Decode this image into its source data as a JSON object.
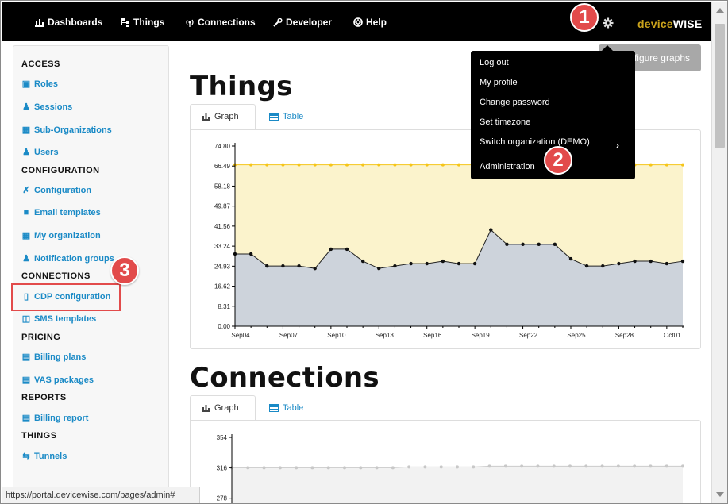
{
  "nav": {
    "items": [
      {
        "label": "Dashboards",
        "icon": "bar-chart-icon"
      },
      {
        "label": "Things",
        "icon": "sitemap-icon"
      },
      {
        "label": "Connections",
        "icon": "signal-icon"
      },
      {
        "label": "Developer",
        "icon": "wrench-icon"
      },
      {
        "label": "Help",
        "icon": "lifebuoy-icon"
      }
    ],
    "logo_prefix": "device",
    "logo_suffix": "WISE"
  },
  "sidebar": {
    "sections": [
      {
        "title": "ACCESS",
        "items": [
          "Roles",
          "Sessions",
          "Sub-Organizations",
          "Users"
        ]
      },
      {
        "title": "CONFIGURATION",
        "items": [
          "Configuration",
          "Email templates",
          "My organization",
          "Notification groups"
        ]
      },
      {
        "title": "CONNECTIONS",
        "items": [
          "CDP configuration",
          "SMS templates"
        ]
      },
      {
        "title": "PRICING",
        "items": [
          "Billing plans",
          "VAS packages"
        ]
      },
      {
        "title": "REPORTS",
        "items": [
          "Billing report"
        ]
      },
      {
        "title": "THINGS",
        "items": [
          "Tunnels"
        ]
      }
    ]
  },
  "main": {
    "things_title": "Things",
    "connections_title": "Connections",
    "tab_graph": "Graph",
    "tab_table": "Table",
    "configure_button": "Configure graphs"
  },
  "dropdown": {
    "items": [
      "Log out",
      "My profile",
      "Change password",
      "Set timezone",
      "Switch organization (DEMO)",
      "Administration"
    ]
  },
  "badges": [
    "1",
    "2",
    "3"
  ],
  "status_url": "https://portal.devicewise.com/pages/admin#",
  "colors": {
    "accent": "#1a8ac6",
    "badge": "#e24b4b",
    "limit_line": "#f5c518",
    "limit_fill": "#fbf3cc",
    "area_fill": "#cdd3db",
    "conn_fill": "#f2f2f2"
  },
  "chart_data": [
    {
      "type": "area",
      "title": "",
      "yticks": [
        "0.00",
        "8.31",
        "16.62",
        "24.93",
        "33.24",
        "41.56",
        "49.87",
        "58.18",
        "66.49",
        "74.80"
      ],
      "ylim": [
        0,
        74.8
      ],
      "xticks": [
        "Sep04",
        "Sep07",
        "Sep10",
        "Sep13",
        "Sep16",
        "Sep19",
        "Sep22",
        "Sep25",
        "Sep28",
        "Oct01"
      ],
      "limit_value": 67,
      "series": [
        {
          "values": [
            30,
            30,
            25,
            25,
            25,
            24,
            32,
            32,
            27,
            24,
            25,
            26,
            26,
            27,
            26,
            26,
            40,
            34,
            34,
            34,
            34,
            28,
            25,
            25,
            26,
            27,
            27,
            26,
            27
          ]
        }
      ]
    },
    {
      "type": "area",
      "title": "",
      "yticks": [
        "278",
        "316",
        "354"
      ],
      "ylim": [
        240,
        354
      ],
      "series": [
        {
          "values": [
            316,
            316,
            316,
            316,
            316,
            316,
            316,
            316,
            316,
            316,
            316,
            317,
            317,
            317,
            317,
            317,
            318,
            318,
            318,
            318,
            318,
            318,
            318,
            318,
            318,
            318,
            318,
            318,
            318
          ]
        }
      ]
    }
  ]
}
